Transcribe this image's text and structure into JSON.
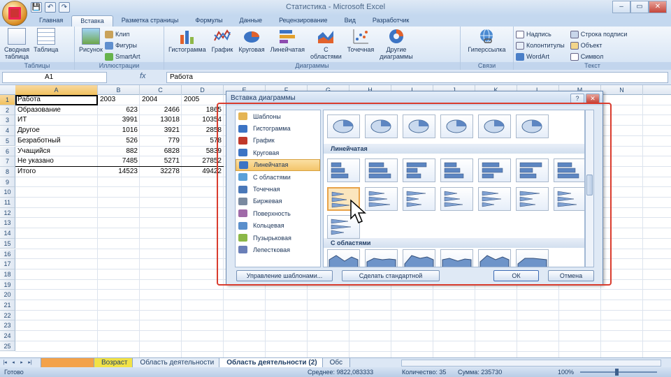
{
  "window": {
    "title": "Статистика - Microsoft Excel",
    "controls": [
      "–",
      "▭",
      "✕"
    ]
  },
  "qat": [
    "💾",
    "↶",
    "↷"
  ],
  "tabs": [
    "Главная",
    "Вставка",
    "Разметка страницы",
    "Формулы",
    "Данные",
    "Рецензирование",
    "Вид",
    "Разработчик"
  ],
  "ribbon": {
    "tables": {
      "label": "Таблицы",
      "pivot": "Сводная\nтаблица",
      "table": "Таблица"
    },
    "illustrations": {
      "label": "Иллюстрации",
      "picture": "Рисунок",
      "clip": "Клип",
      "shapes": "Фигуры",
      "smartart": "SmartArt"
    },
    "charts": {
      "label": "Диаграммы",
      "histogram": "Гистограмма",
      "graph": "График",
      "pie": "Круговая",
      "line": "Линейчатая",
      "area": "С\nобластями",
      "scatter": "Точечная",
      "other": "Другие\nдиаграммы"
    },
    "links": {
      "label": "Связи",
      "hyperlink": "Гиперссылка"
    },
    "text": {
      "label": "Текст",
      "textbox": "Надпись",
      "headerfooter": "Колонтитулы",
      "wordart": "WordArt",
      "signature": "Строка подписи",
      "object": "Объект",
      "symbol": "Символ"
    }
  },
  "formula_bar": {
    "cell": "A1",
    "fx": "fx",
    "value": "Работа"
  },
  "columns": [
    "A",
    "B",
    "C",
    "D",
    "E",
    "F",
    "G",
    "H",
    "I",
    "J",
    "K",
    "L",
    "M",
    "N"
  ],
  "rows": [
    "1",
    "2",
    "3",
    "4",
    "5",
    "6",
    "7",
    "8",
    "9",
    "10",
    "11",
    "12",
    "13",
    "14",
    "15",
    "16",
    "17",
    "18",
    "19",
    "20",
    "21",
    "22",
    "23",
    "24",
    "25"
  ],
  "table": {
    "header": [
      "Работа",
      "2003",
      "2004",
      "2005"
    ],
    "data": [
      [
        "Образование",
        "623",
        "2466",
        "1865"
      ],
      [
        "ИТ",
        "3991",
        "13018",
        "10354"
      ],
      [
        "Другое",
        "1016",
        "3921",
        "2858"
      ],
      [
        "Безработный",
        "526",
        "779",
        "578"
      ],
      [
        "Учащийся",
        "882",
        "6828",
        "5839"
      ],
      [
        "Не указано",
        "7485",
        "5271",
        "27852"
      ],
      [
        "Итого",
        "14523",
        "32278",
        "49422"
      ]
    ]
  },
  "sheet_tabs": [
    "Возраст",
    "Область деятельности",
    "Область деятельности (2)",
    "Обс"
  ],
  "status": {
    "ready": "Готово",
    "average": "Среднее: 9822,083333",
    "count": "Количество: 35",
    "sum": "Сумма: 235730",
    "zoom": "100%"
  },
  "dialog": {
    "title": "Вставка диаграммы",
    "help": "?",
    "close": "✕",
    "types": [
      "Шаблоны",
      "Гистограмма",
      "График",
      "Круговая",
      "Линейчатая",
      "С областями",
      "Точечная",
      "Биржевая",
      "Поверхность",
      "Кольцевая",
      "Пузырьковая",
      "Лепестковая"
    ],
    "selected_type": "Линейчатая",
    "section_line": "Линейчатая",
    "section_area": "С областями",
    "manage_btn": "Управление шаблонами...",
    "default_btn": "Сделать стандартной",
    "ok": "ОК",
    "cancel": "Отмена"
  },
  "colors": {
    "accent": "#f4c56a",
    "frame": "#d93c2e"
  }
}
